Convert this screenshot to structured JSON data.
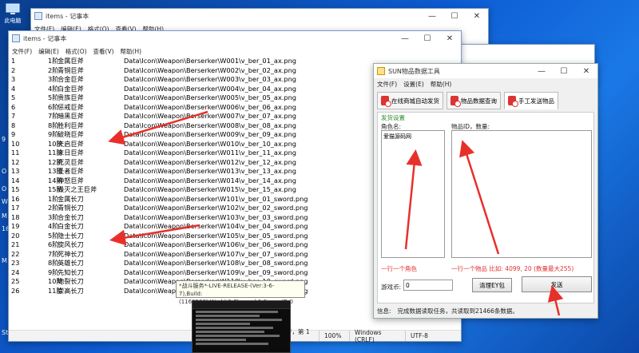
{
  "desktop": {
    "top_icon_label": "此电脑",
    "left_labels": [
      "9",
      "O",
      "O",
      "W",
      "M",
      "16",
      "M",
      "Start"
    ]
  },
  "notepad_back": {
    "title": "items - 记事本",
    "menu": [
      "文件(F)",
      "编辑(E)",
      "格式(O)",
      "查看(V)",
      "帮助(H)"
    ],
    "buttons": [
      "—",
      "☐",
      "✕"
    ]
  },
  "notepad": {
    "title": "items - 记事本",
    "menu": [
      "文件(F)",
      "编辑(E)",
      "格式(O)",
      "查看(V)",
      "帮助(H)"
    ],
    "buttons": [
      "—",
      "☐",
      "✕"
    ],
    "rows": [
      [
        "1",
        "1阶",
        "金属巨斧",
        "Data\\Icon\\Weapon\\Berserker\\W001\\v_ber_01_ax.png"
      ],
      [
        "2",
        "2阶",
        "青铜巨斧",
        "Data\\Icon\\Weapon\\Berserker\\W002\\v_ber_02_ax.png"
      ],
      [
        "3",
        "3阶",
        "合金巨斧",
        "Data\\Icon\\Weapon\\Berserker\\W003\\v_ber_03_ax.png"
      ],
      [
        "4",
        "4阶",
        "白金巨斧",
        "Data\\Icon\\Weapon\\Berserker\\W004\\v_ber_04_ax.png"
      ],
      [
        "5",
        "5阶",
        "贵族巨斧",
        "Data\\Icon\\Weapon\\Berserker\\W005\\v_ber_05_ax.png"
      ],
      [
        "6",
        "6阶",
        "惩戒巨斧",
        "Data\\Icon\\Weapon\\Berserker\\W006\\v_ber_06_ax.png"
      ],
      [
        "7",
        "7阶",
        "暗黑巨斧",
        "Data\\Icon\\Weapon\\Berserker\\W007\\v_ber_07_ax.png"
      ],
      [
        "8",
        "8阶",
        "胜利巨斧",
        "Data\\Icon\\Weapon\\Berserker\\W008\\v_ber_08_ax.png"
      ],
      [
        "9",
        "9阶",
        "破晓巨斧",
        "Data\\Icon\\Weapon\\Berserker\\W009\\v_ber_09_ax.png"
      ],
      [
        "10",
        "10阶",
        "天启巨斧",
        "Data\\Icon\\Weapon\\Berserker\\W010\\v_ber_10_ax.png"
      ],
      [
        "11",
        "11阶",
        "末日巨斧",
        "Data\\Icon\\Weapon\\Berserker\\W011\\v_ber_11_ax.png"
      ],
      [
        "12",
        "12阶",
        "死灵巨斧",
        "Data\\Icon\\Weapon\\Berserker\\W012\\v_ber_12_ax.png"
      ],
      [
        "13",
        "13阶",
        "圣者巨斧",
        "Data\\Icon\\Weapon\\Berserker\\W013\\v_ber_13_ax.png"
      ],
      [
        "14",
        "14阶",
        "神怒巨斧",
        "Data\\Icon\\Weapon\\Berserker\\W014\\v_ber_14_ax.png"
      ],
      [
        "15",
        "15阶",
        "毁灭之王巨斧",
        "Data\\Icon\\Weapon\\Berserker\\W015\\v_ber_15_ax.png"
      ],
      [
        "16",
        "1阶",
        "金属长刀",
        "Data\\Icon\\Weapon\\Berserker\\W101\\v_ber_01_sword.png"
      ],
      [
        "17",
        "2阶",
        "青铜长刀",
        "Data\\Icon\\Weapon\\Berserker\\W102\\v_ber_02_sword.png"
      ],
      [
        "18",
        "3阶",
        "合金长刀",
        "Data\\Icon\\Weapon\\Berserker\\W103\\v_ber_03_sword.png"
      ],
      [
        "19",
        "4阶",
        "白金长刀",
        "Data\\Icon\\Weapon\\Berserker\\W104\\v_ber_04_sword.png"
      ],
      [
        "20",
        "5阶",
        "隐士长刀",
        "Data\\Icon\\Weapon\\Berserker\\W105\\v_ber_05_sword.png"
      ],
      [
        "21",
        "6阶",
        "旋风长刀",
        "Data\\Icon\\Weapon\\Berserker\\W106\\v_ber_06_sword.png"
      ],
      [
        "22",
        "7阶",
        "死神长刀",
        "Data\\Icon\\Weapon\\Berserker\\W107\\v_ber_07_sword.png"
      ],
      [
        "23",
        "8阶",
        "英雄长刀",
        "Data\\Icon\\Weapon\\Berserker\\W108\\v_ber_08_sword.png"
      ],
      [
        "24",
        "9阶",
        "先知长刀",
        "Data\\Icon\\Weapon\\Berserker\\W109\\v_ber_09_sword.png"
      ],
      [
        "25",
        "10阶",
        "地裂长刀",
        "Data\\Icon\\Weapon\\Berserker\\W110\\v_ber_10_sword.png"
      ],
      [
        "26",
        "11阶",
        "崇高长刀",
        "Data\\Icon\\Weapon\\Berserker\\W111\\v_ber_11_sword.png"
      ]
    ],
    "status": [
      "第 1 行，第 1 列",
      "100%",
      "Windows (CRLF)",
      "UTF-8"
    ]
  },
  "sun_tool": {
    "title": "SUN物品数据工具",
    "buttons": [
      "—",
      "☐",
      "✕"
    ],
    "menu": [
      "文件(F)",
      "设置(E)",
      "帮助(H)"
    ],
    "tabs": [
      "在线商城自动发货",
      "物品数据查询",
      "手工发送物品"
    ],
    "section_title": "发货设置",
    "role_label": "角色名:",
    "role_value": "爱猫源码网",
    "item_label": "物品ID，数量:",
    "item_value": "",
    "role_hint": "一行一个角色",
    "item_hint": "一行一个物品 比如: 4099, 20 (数量最大255)",
    "coin_label": "游戏币:",
    "coin_value": "0",
    "clear_button": "清理EY包",
    "send_button": "发送",
    "status_label": "信息:",
    "status_text": "完成数据读取任务，共读取到21466条数据。"
  },
  "tooltip": {
    "line1": "*战斗服务*-LIVE-RELEASE-(Ver:3-6-",
    "line2": "7),Build:(1160206),World:0,Channel:1,ServerID:0"
  }
}
